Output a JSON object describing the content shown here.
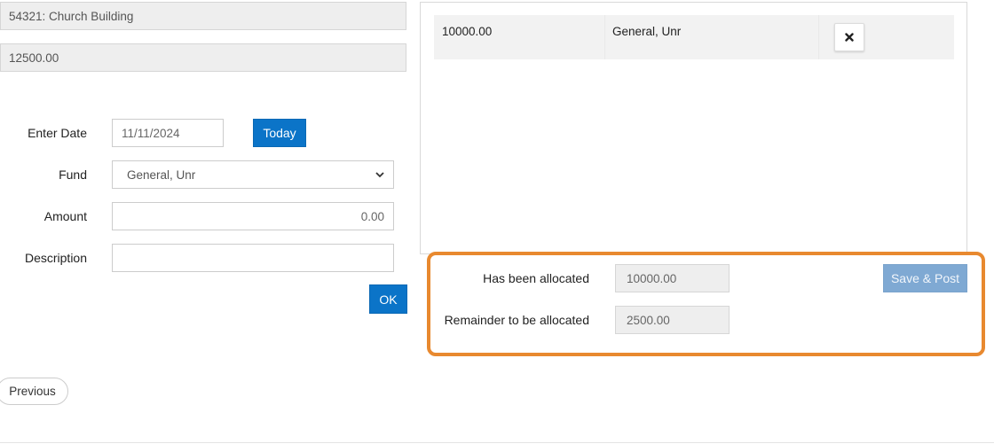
{
  "header_fields": {
    "account": "54321: Church Building",
    "total": "12500.00"
  },
  "form": {
    "date_label": "Enter Date",
    "date_value": "11/11/2024",
    "today_button": "Today",
    "fund_label": "Fund",
    "fund_selected": "General, Unr",
    "amount_label": "Amount",
    "amount_value": "0.00",
    "description_label": "Description",
    "description_value": "",
    "ok_button": "OK"
  },
  "allocations": [
    {
      "amount": "10000.00",
      "fund": "General, Unr",
      "delete_icon": "close-icon"
    }
  ],
  "summary": {
    "allocated_label": "Has been allocated",
    "allocated_value": "10000.00",
    "remainder_label": "Remainder to be allocated",
    "remainder_value": "2500.00",
    "save_button": "Save & Post"
  },
  "nav": {
    "previous_button": "Previous"
  },
  "colors": {
    "primary": "#0b74c8",
    "disabled_primary": "#7fa9d3",
    "highlight": "#e8892f"
  }
}
